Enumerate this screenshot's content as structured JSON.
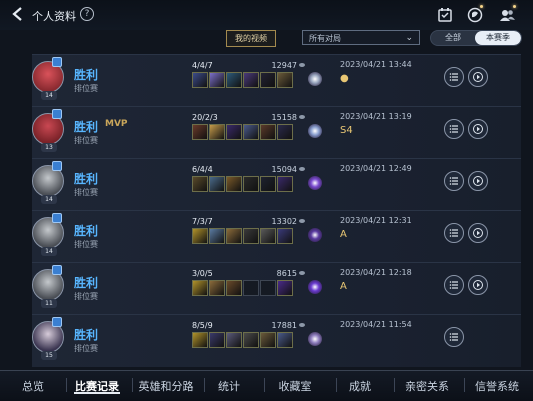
{
  "header": {
    "title": "个人资料",
    "help": "?"
  },
  "filters": {
    "my_videos": "我的视频",
    "mode_select": "所有对局",
    "seg_all": "全部",
    "seg_season": "本赛季"
  },
  "matches": [
    {
      "level": "14",
      "result": "胜利",
      "mode": "排位赛",
      "mvp": "",
      "kda": "4/4/7",
      "gold": "12947",
      "date": "2023/04/21 13:44",
      "tags": "●",
      "has_play": true
    },
    {
      "level": "13",
      "result": "胜利",
      "mode": "排位赛",
      "mvp": "MVP",
      "kda": "20/2/3",
      "gold": "15158",
      "date": "2023/04/21 13:19",
      "tags": "S4",
      "has_play": true
    },
    {
      "level": "14",
      "result": "胜利",
      "mode": "排位赛",
      "mvp": "",
      "kda": "6/4/4",
      "gold": "15094",
      "date": "2023/04/21 12:49",
      "tags": "",
      "has_play": true
    },
    {
      "level": "14",
      "result": "胜利",
      "mode": "排位赛",
      "mvp": "",
      "kda": "7/3/7",
      "gold": "13302",
      "date": "2023/04/21 12:31",
      "tags": "A",
      "has_play": true
    },
    {
      "level": "11",
      "result": "胜利",
      "mode": "排位赛",
      "mvp": "",
      "kda": "3/0/5",
      "gold": "8615",
      "date": "2023/04/21 12:18",
      "tags": "A",
      "has_play": true
    },
    {
      "level": "15",
      "result": "胜利",
      "mode": "排位赛",
      "mvp": "",
      "kda": "8/5/9",
      "gold": "17881",
      "date": "2023/04/21 11:54",
      "tags": "",
      "has_play": false
    }
  ],
  "bottom_tabs": [
    "总览",
    "比赛记录",
    "英雄和分路",
    "统计",
    "收藏室",
    "成就",
    "亲密关系",
    "信誉系统"
  ],
  "active_tab": 1,
  "colors": {
    "win": "#58b6ff",
    "accent": "#c9a65a"
  }
}
